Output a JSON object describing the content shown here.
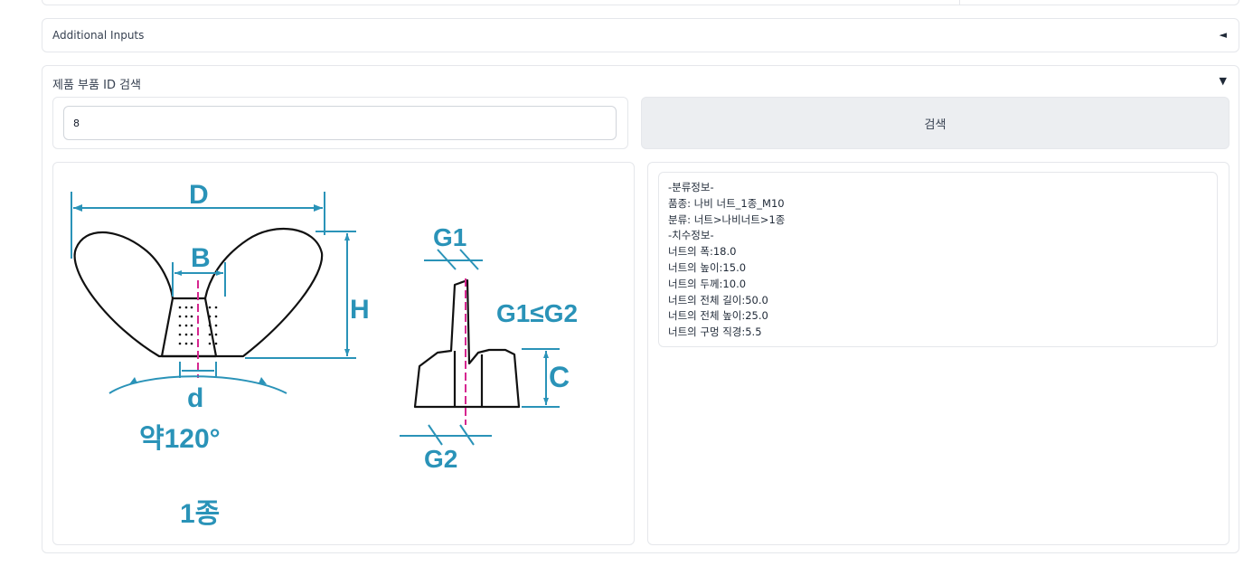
{
  "accordion_additional": {
    "title": "Additional Inputs",
    "caret": "◄"
  },
  "accordion_search": {
    "title": "제품 부품 ID 검색",
    "caret": "▼",
    "input_value": "8",
    "button_label": "검색"
  },
  "drawing": {
    "labels": {
      "D": "D",
      "B": "B",
      "H": "H",
      "d": "d",
      "angle": "약120°",
      "type": "1종",
      "G1": "G1",
      "G2": "G2",
      "relation": "G1≤G2",
      "C": "C"
    },
    "line_color": "#2a93b8",
    "center_color": "#d6268f"
  },
  "info": {
    "lines": [
      "-분류정보-",
      "품종: 나비 너트_1종_M10",
      "분류: 너트>나비너트>1종",
      "-치수정보-",
      "너트의 폭:18.0",
      "너트의 높이:15.0",
      "너트의 두께:10.0",
      "너트의 전체 길이:50.0",
      "너트의 전체 높이:25.0",
      "너트의 구멍 직경:5.5"
    ]
  }
}
